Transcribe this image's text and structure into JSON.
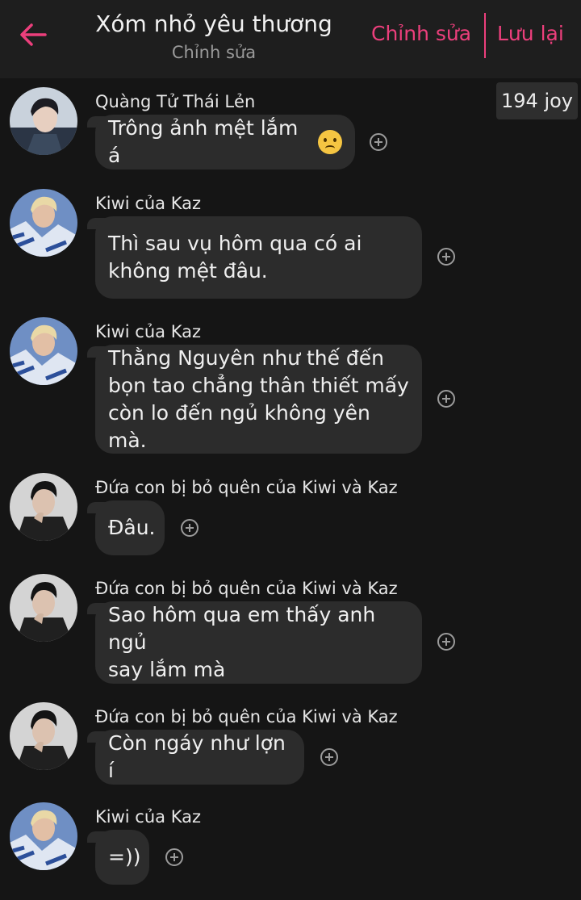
{
  "header": {
    "title": "Xóm nhỏ yêu thương",
    "subtitle": "Chỉnh sửa",
    "edit_label": "Chỉnh sửa",
    "save_label": "Lưu lại",
    "joy_badge": "194 joy",
    "accent_color": "#ec3f7c"
  },
  "messages": [
    {
      "sender": "Quàng Tử Thái Lẻn",
      "text": "Trông ảnh mệt lắm á",
      "emoji": "sad-emoji-icon",
      "avatar": "avatar-dark-hair"
    },
    {
      "sender": "Kiwi của Kaz",
      "text": "Thì sau vụ hôm qua có ai\nkhông mệt đâu.",
      "avatar": "avatar-blond-hair"
    },
    {
      "sender": "Kiwi của Kaz",
      "text": "Thằng Nguyên như thế đến\nbọn tao chẳng thân thiết mấy\ncòn lo đến ngủ không yên mà.",
      "avatar": "avatar-blond-hair"
    },
    {
      "sender": "Đứa con bị bỏ quên của Kiwi và Kaz",
      "text": "Đâu.",
      "avatar": "avatar-dark-suit"
    },
    {
      "sender": "Đứa con bị bỏ quên của Kiwi và Kaz",
      "text": "Sao hôm qua em thấy anh ngủ\nsay lắm mà",
      "avatar": "avatar-dark-suit"
    },
    {
      "sender": "Đứa con bị bỏ quên của Kiwi và Kaz",
      "text": "Còn ngáy như lợn í",
      "avatar": "avatar-dark-suit"
    },
    {
      "sender": "Kiwi của Kaz",
      "text": "=))",
      "avatar": "avatar-blond-hair"
    }
  ]
}
